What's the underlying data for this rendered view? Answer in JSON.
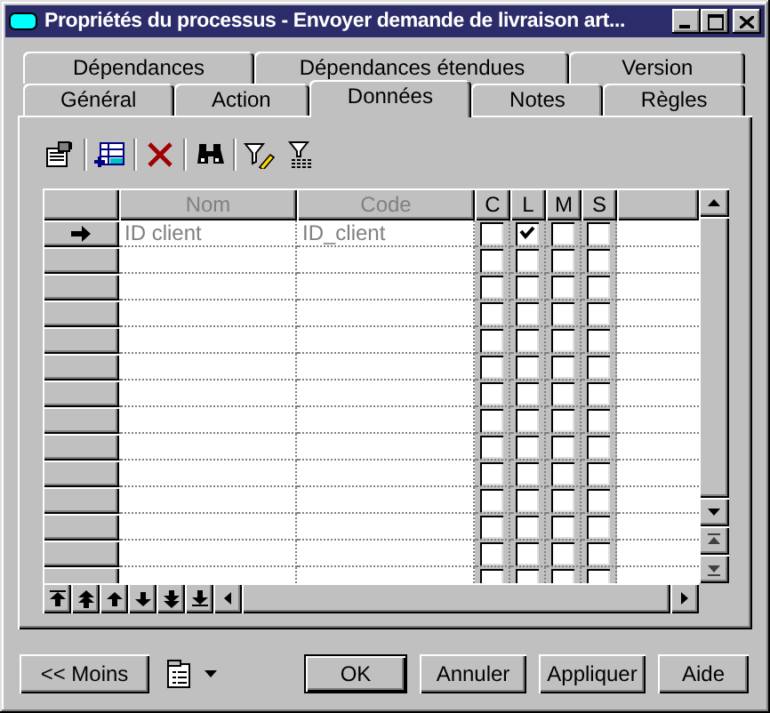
{
  "window": {
    "title": "Propriétés du processus - Envoyer demande de livraison art..."
  },
  "tab_rows": [
    [
      {
        "label": "Dépendances",
        "selected": false
      },
      {
        "label": "Dépendances étendues",
        "selected": false
      },
      {
        "label": "Version",
        "selected": false
      }
    ],
    [
      {
        "label": "Général",
        "selected": false
      },
      {
        "label": "Action",
        "selected": false
      },
      {
        "label": "Données",
        "selected": true
      },
      {
        "label": "Notes",
        "selected": false
      },
      {
        "label": "Règles",
        "selected": false
      }
    ]
  ],
  "columns": [
    "Nom",
    "Code",
    "C",
    "L",
    "M",
    "S"
  ],
  "rows": [
    {
      "name": "ID client",
      "code": "ID_client",
      "current": true,
      "flags": [
        false,
        true,
        false,
        false
      ]
    },
    {
      "current": false,
      "flags": [
        false,
        false,
        false,
        false
      ]
    },
    {
      "current": false,
      "flags": [
        false,
        false,
        false,
        false
      ]
    },
    {
      "current": false,
      "flags": [
        false,
        false,
        false,
        false
      ]
    },
    {
      "current": false,
      "flags": [
        false,
        false,
        false,
        false
      ]
    },
    {
      "current": false,
      "flags": [
        false,
        false,
        false,
        false
      ]
    },
    {
      "current": false,
      "flags": [
        false,
        false,
        false,
        false
      ]
    },
    {
      "current": false,
      "flags": [
        false,
        false,
        false,
        false
      ]
    },
    {
      "current": false,
      "flags": [
        false,
        false,
        false,
        false
      ]
    },
    {
      "current": false,
      "flags": [
        false,
        false,
        false,
        false
      ]
    },
    {
      "current": false,
      "flags": [
        false,
        false,
        false,
        false
      ]
    },
    {
      "current": false,
      "flags": [
        false,
        false,
        false,
        false
      ]
    },
    {
      "current": false,
      "flags": [
        false,
        false,
        false,
        false
      ]
    },
    {
      "current": false,
      "flags": [
        false,
        false,
        false,
        false
      ]
    }
  ],
  "buttons": {
    "less": "<< Moins",
    "ok": "OK",
    "cancel": "Annuler",
    "apply": "Appliquer",
    "help": "Aide"
  }
}
